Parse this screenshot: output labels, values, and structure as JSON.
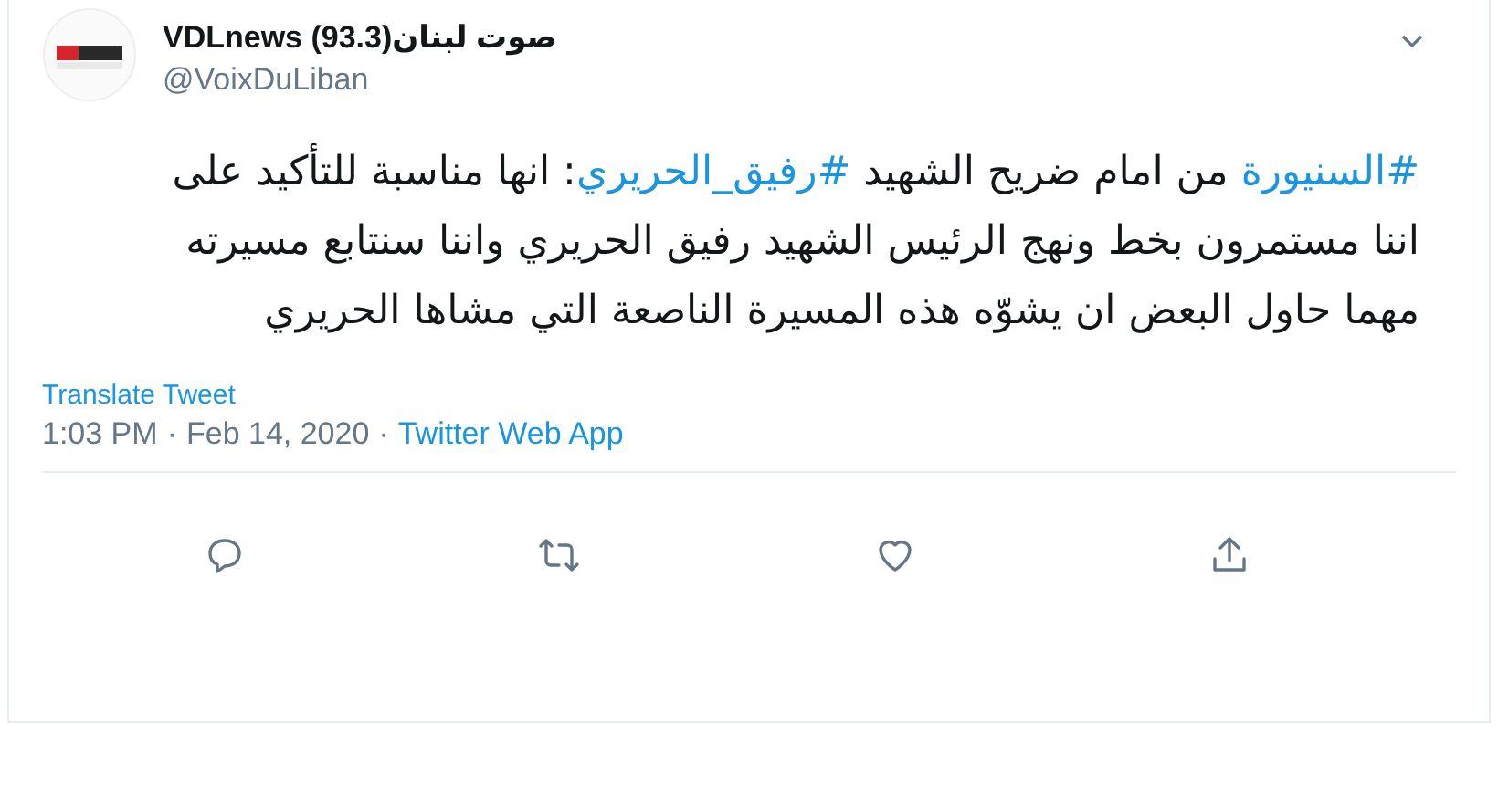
{
  "author": {
    "display_name": "VDLnews (93.3)صوت لبنان",
    "handle": "@VoixDuLiban"
  },
  "tweet": {
    "segments": [
      {
        "kind": "hashtag",
        "text": "#السنيورة"
      },
      {
        "kind": "text",
        "text": " من امام ضريح الشهيد "
      },
      {
        "kind": "hashtag",
        "text": "#رفيق_الحريري"
      },
      {
        "kind": "text",
        "text": ": انها مناسبة للتأكيد على اننا مستمرون بخط ونهج الرئيس الشهيد رفيق الحريري واننا سنتابع مسيرته مهما حاول البعض ان يشوّه هذه المسيرة الناصعة التي مشاها الحريري"
      }
    ]
  },
  "translate_link": "Translate Tweet",
  "meta": {
    "time": "1:03 PM",
    "separator": "·",
    "date": "Feb 14, 2020",
    "source": "Twitter Web App"
  },
  "actions": [
    {
      "kind": "reply"
    },
    {
      "kind": "retweet"
    },
    {
      "kind": "like"
    },
    {
      "kind": "share"
    }
  ]
}
